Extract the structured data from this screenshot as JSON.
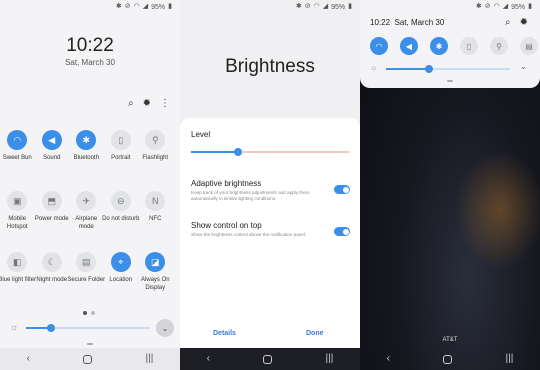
{
  "colors": {
    "accent": "#3b8fe8"
  },
  "status": {
    "battery": "95%",
    "icons": [
      "bluetooth-icon",
      "mute-icon",
      "wifi-icon",
      "signal-icon",
      "battery-icon"
    ]
  },
  "panel1": {
    "time": "10:22",
    "date": "Sat, March 30",
    "rows": [
      [
        {
          "label": "Sweet Bun",
          "icon": "wifi-icon",
          "on": true
        },
        {
          "label": "Sound",
          "icon": "sound-icon",
          "on": true
        },
        {
          "label": "Bluetooth",
          "icon": "bluetooth-icon",
          "on": true
        },
        {
          "label": "Portrait",
          "icon": "portrait-icon",
          "on": false
        },
        {
          "label": "Flashlight",
          "icon": "flashlight-icon",
          "on": false
        }
      ],
      [
        {
          "label": "Mobile Hotspot",
          "icon": "hotspot-icon",
          "on": false
        },
        {
          "label": "Power mode",
          "icon": "power-mode-icon",
          "on": false
        },
        {
          "label": "Airplane mode",
          "icon": "airplane-icon",
          "on": false
        },
        {
          "label": "Do not disturb",
          "icon": "dnd-icon",
          "on": false
        },
        {
          "label": "NFC",
          "icon": "nfc-icon",
          "on": false
        }
      ],
      [
        {
          "label": "Blue light filter",
          "icon": "blue-light-icon",
          "on": false
        },
        {
          "label": "Night mode",
          "icon": "night-mode-icon",
          "on": false
        },
        {
          "label": "Secure Folder",
          "icon": "secure-folder-icon",
          "on": false
        },
        {
          "label": "Location",
          "icon": "location-icon",
          "on": true
        },
        {
          "label": "Always On Display",
          "icon": "aod-icon",
          "on": true
        }
      ]
    ],
    "brightness": 0.2
  },
  "panel2": {
    "title": "Brightness",
    "level_label": "Level",
    "level": 0.3,
    "adaptive_title": "Adaptive brightness",
    "adaptive_desc": "Keep track of your brightness adjustments and apply them automatically in similar lighting conditions.",
    "show_title": "Show control on top",
    "show_desc": "Show the brightness control above the notification panel.",
    "details": "Details",
    "done": "Done"
  },
  "panel3": {
    "time": "10:22",
    "date": "Sat, March 30",
    "brightness": 0.35,
    "carrier": "AT&T"
  }
}
